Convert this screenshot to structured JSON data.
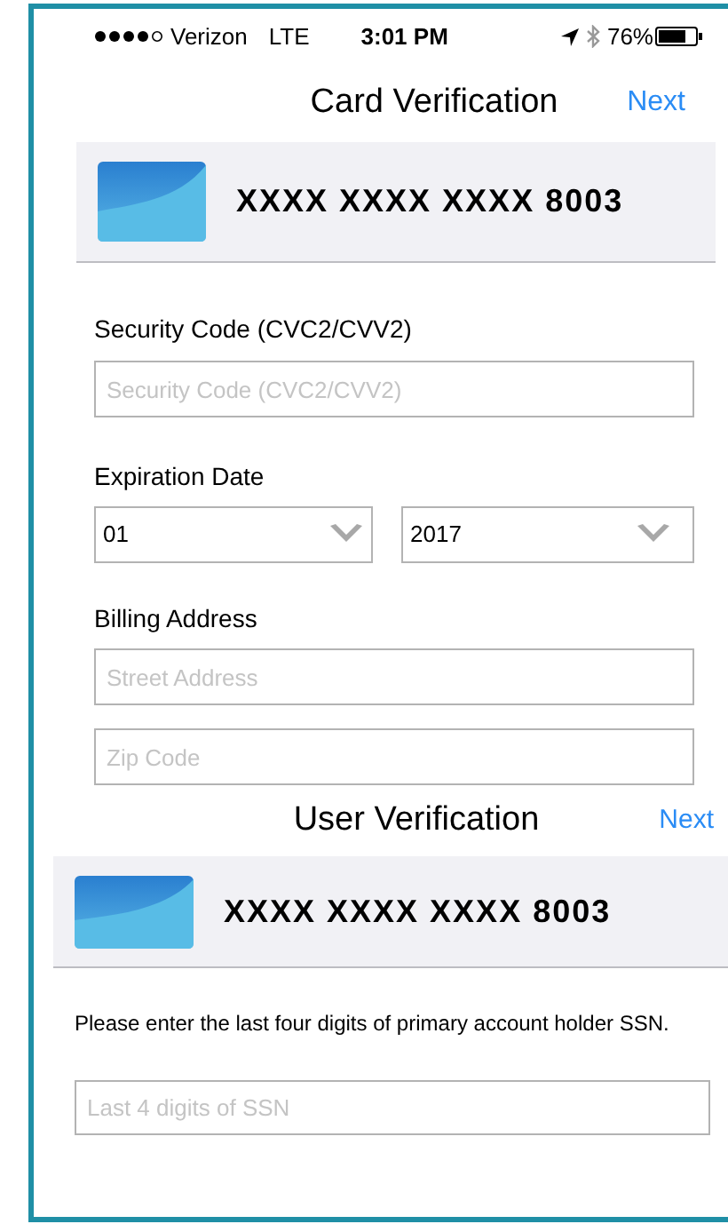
{
  "status_bar": {
    "carrier": "Verizon",
    "network": "LTE",
    "time": "3:01 PM",
    "battery": "76%"
  },
  "card_verification": {
    "title": "Card Verification",
    "next": "Next",
    "card_number": "XXXX XXXX XXXX 8003",
    "security_code": {
      "label": "Security Code (CVC2/CVV2)",
      "placeholder": "Security Code (CVC2/CVV2)"
    },
    "expiration": {
      "label": "Expiration Date",
      "month": "01",
      "year": "2017"
    },
    "billing": {
      "label": "Billing Address",
      "street_placeholder": "Street Address",
      "zip_placeholder": "Zip Code"
    }
  },
  "user_verification": {
    "title": "User Verification",
    "next": "Next",
    "card_number": "XXXX XXXX XXXX 8003",
    "instructions": "Please enter the last four digits of primary account holder SSN.",
    "ssn_placeholder": "Last 4 digits of SSN"
  }
}
